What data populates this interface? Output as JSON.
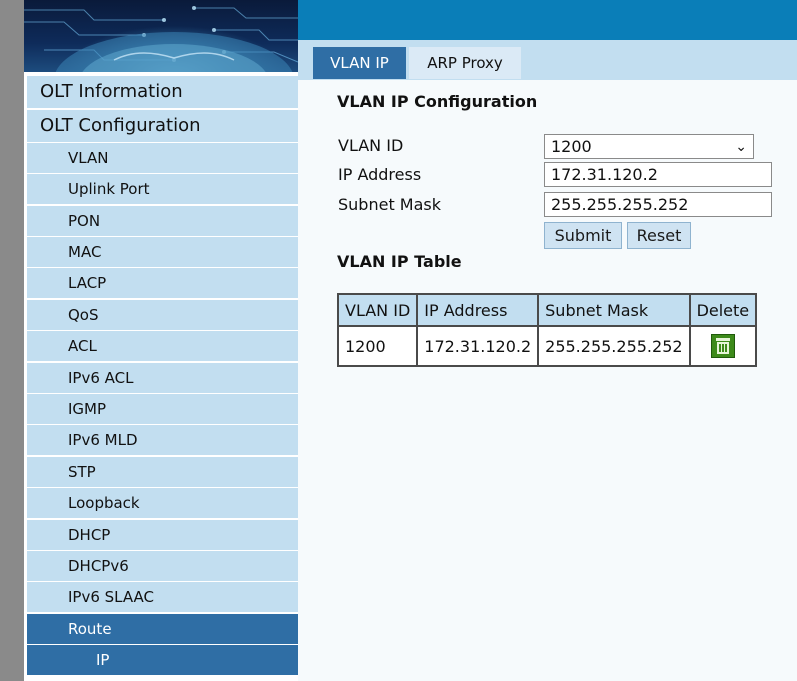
{
  "tabs": [
    {
      "label": "VLAN IP",
      "active": true
    },
    {
      "label": "ARP Proxy",
      "active": false
    }
  ],
  "sidebar": {
    "items": [
      {
        "label": "OLT Information",
        "level": 0
      },
      {
        "label": "OLT Configuration",
        "level": 0
      },
      {
        "label": "VLAN",
        "level": 1
      },
      {
        "label": "Uplink Port",
        "level": 1
      },
      {
        "label": "PON",
        "level": 1
      },
      {
        "label": "MAC",
        "level": 1
      },
      {
        "label": "LACP",
        "level": 1
      },
      {
        "label": "QoS",
        "level": 1
      },
      {
        "label": "ACL",
        "level": 1
      },
      {
        "label": "IPv6 ACL",
        "level": 1
      },
      {
        "label": "IGMP",
        "level": 1
      },
      {
        "label": "IPv6 MLD",
        "level": 1
      },
      {
        "label": "STP",
        "level": 1
      },
      {
        "label": "Loopback",
        "level": 1
      },
      {
        "label": "DHCP",
        "level": 1
      },
      {
        "label": "DHCPv6",
        "level": 1
      },
      {
        "label": "IPv6 SLAAC",
        "level": 1
      },
      {
        "label": "Route",
        "level": 1,
        "active": true
      },
      {
        "label": "IP",
        "level": 2,
        "active": true
      }
    ]
  },
  "config": {
    "title": "VLAN IP Configuration",
    "vlan_id_label": "VLAN ID",
    "vlan_id_value": "1200",
    "ip_label": "IP Address",
    "ip_value": "172.31.120.2",
    "mask_label": "Subnet Mask",
    "mask_value": "255.255.255.252",
    "submit_label": "Submit",
    "reset_label": "Reset"
  },
  "table": {
    "title": "VLAN IP Table",
    "headers": [
      "VLAN ID",
      "IP Address",
      "Subnet Mask",
      "Delete"
    ],
    "rows": [
      [
        "1200",
        "172.31.120.2",
        "255.255.255.252"
      ]
    ],
    "delete_icon": "trash-icon"
  },
  "colors": {
    "top_bar": "#0a7eb8",
    "active_item": "#2f6ea5",
    "menu_bg": "#c2def0"
  }
}
